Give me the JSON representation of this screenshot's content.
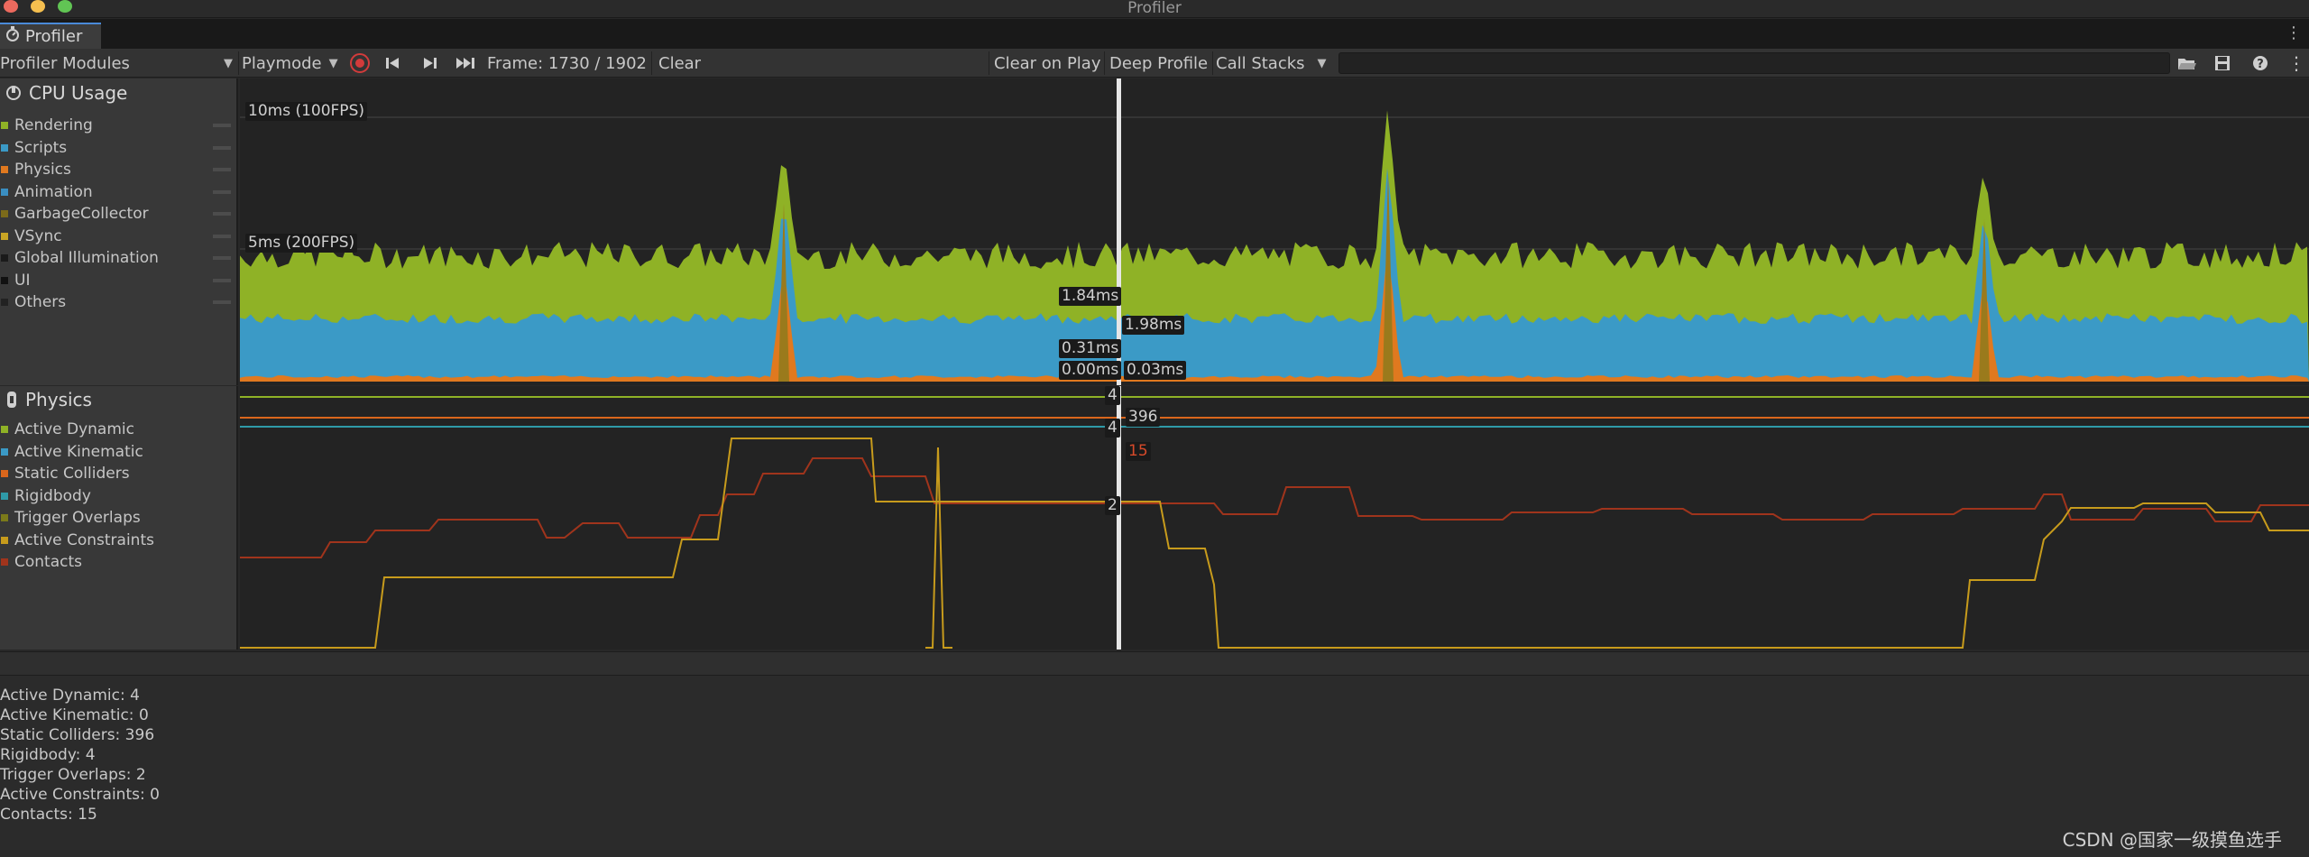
{
  "window": {
    "title": "Profiler"
  },
  "tab": {
    "label": "Profiler"
  },
  "toolbar": {
    "modules_label": "Profiler Modules",
    "playmode_label": "Playmode",
    "frame_label": "Frame: 1730 / 1902",
    "clear_label": "Clear",
    "clear_on_play_label": "Clear on Play",
    "deep_profile_label": "Deep Profile",
    "call_stacks_label": "Call Stacks"
  },
  "cpu_module": {
    "title": "CPU Usage",
    "legend": [
      {
        "label": "Rendering",
        "color": "#8fb226"
      },
      {
        "label": "Scripts",
        "color": "#3b9ac6"
      },
      {
        "label": "Physics",
        "color": "#e0791f"
      },
      {
        "label": "Animation",
        "color": "#3a8ec1"
      },
      {
        "label": "GarbageCollector",
        "color": "#7b6a1a"
      },
      {
        "label": "VSync",
        "color": "#c9a524"
      },
      {
        "label": "Global Illumination",
        "color": "#1a1a1a"
      },
      {
        "label": "UI",
        "color": "#111111"
      },
      {
        "label": "Others",
        "color": "#222222"
      }
    ],
    "gridlines": [
      "10ms (100FPS)",
      "5ms (200FPS)"
    ],
    "selection_labels": [
      "1.84ms",
      "1.98ms",
      "0.31ms",
      "0.00ms",
      "0.03ms"
    ]
  },
  "physics_module": {
    "title": "Physics",
    "legend": [
      {
        "label": "Active Dynamic",
        "color": "#8fb226"
      },
      {
        "label": "Active Kinematic",
        "color": "#3b9ac6"
      },
      {
        "label": "Static Colliders",
        "color": "#d9661c"
      },
      {
        "label": "Rigidbody",
        "color": "#2f9aa8"
      },
      {
        "label": "Trigger Overlaps",
        "color": "#7b7a1a"
      },
      {
        "label": "Active Constraints",
        "color": "#c79b1c"
      },
      {
        "label": "Contacts",
        "color": "#a0341c"
      }
    ],
    "selection_labels": [
      "4",
      "396",
      "4",
      "15",
      "2"
    ]
  },
  "details": {
    "lines": [
      "Active Dynamic: 4",
      "Active Kinematic: 0",
      "Static Colliders: 396",
      "Rigidbody: 4",
      "Trigger Overlaps: 2",
      "Active Constraints: 0",
      "Contacts: 15"
    ]
  },
  "watermark": "CSDN @国家一级摸鱼选手"
}
